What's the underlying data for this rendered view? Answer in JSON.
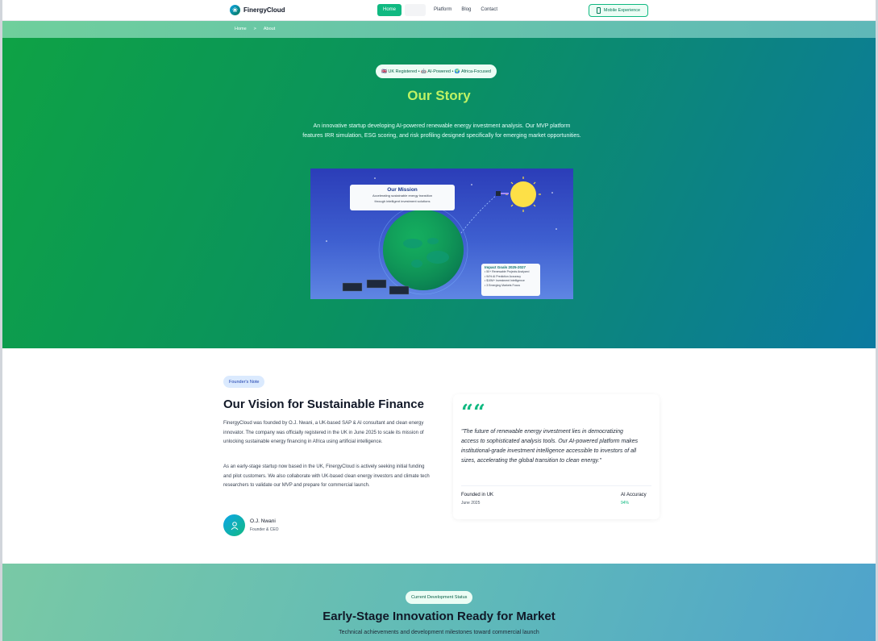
{
  "nav": {
    "brand": "FinergyCloud",
    "links": [
      {
        "label": "Home",
        "active": true
      },
      {
        "label": "",
        "active": false
      },
      {
        "label": "Platform",
        "active": false
      },
      {
        "label": "Blog",
        "active": false
      },
      {
        "label": "Contact",
        "active": false
      }
    ],
    "mobile_button": "Mobile Experience"
  },
  "breadcrumb": {
    "home": "Home",
    "separator": ">",
    "current": "About"
  },
  "hero": {
    "badge": "🇬🇧 UK Registered • 🤖 AI-Powered • 🌍 Africa-Focused",
    "title": "Our Story",
    "description_line1": "An innovative startup developing AI-powered renewable energy investment analysis. Our MVP platform",
    "description_line2": "features IRR simulation, ESG scoring, and risk profiling designed specifically for emerging market opportunities.",
    "mission": {
      "title": "Our Mission",
      "line1": "Accelerating sustainable energy transition",
      "line2": "through intelligent investment solutions"
    },
    "impact": {
      "title": "Impact Goals 2025-2027",
      "items": [
        "• 50+ Renewable Projects Analyzed",
        "• 94% AI Prediction Accuracy",
        "• $10M+ Investment Intelligence",
        "• 3 Emerging Markets Focus"
      ]
    }
  },
  "founder": {
    "tag": "Founder's Note",
    "title": "Our Vision for Sustainable Finance",
    "paragraph1": "FinergyCloud was founded by O.J. Nwani, a UK-based SAP & AI consultant and clean energy innovator. The company was officially registered in the UK in June 2025 to scale its mission of unlocking sustainable energy financing in Africa using artificial intelligence.",
    "paragraph2": "As an early-stage startup now based in the UK, FinergyCloud is actively seeking initial funding and pilot customers. We also collaborate with UK-based clean energy investors and climate tech researchers to validate our MVP and prepare for commercial launch.",
    "name": "O.J. Nwani",
    "role": "Founder & CEO",
    "quote": "\"The future of renewable energy investment lies in democratizing access to sophisticated analysis tools. Our AI-powered platform makes institutional-grade investment intelligence accessible to investors of all sizes, accelerating the global transition to clean energy.\"",
    "quote_mark": "““",
    "stats": [
      {
        "label": "Founded in UK",
        "value": "June 2025",
        "color": "#4b5563"
      },
      {
        "label": "AI Accuracy",
        "value": "94%",
        "color": "#10b981"
      }
    ]
  },
  "status": {
    "tag": "Current Development Status",
    "title": "Early-Stage Innovation Ready for Market",
    "subtitle": "Technical achievements and development milestones toward commercial launch"
  },
  "colors": {
    "accent": "#10b981",
    "hero_title": "#bef264"
  }
}
